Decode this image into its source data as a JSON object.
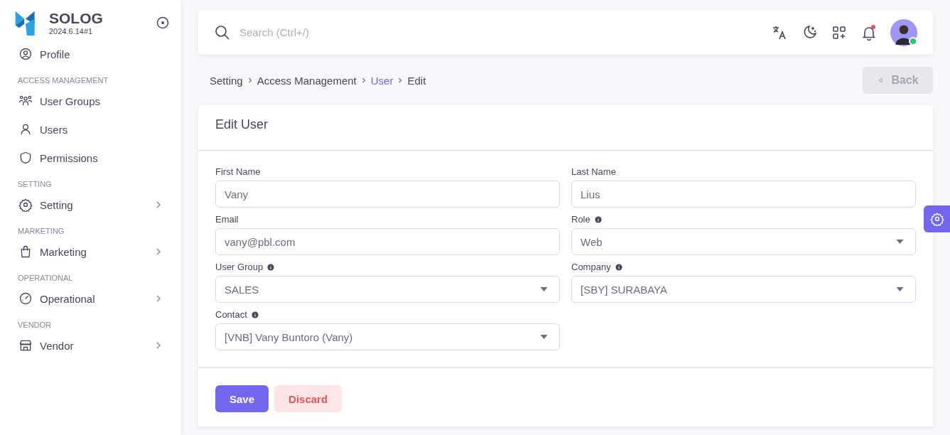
{
  "brand": {
    "name": "SOLOG",
    "version": "2024.6.14#1"
  },
  "sidebar": {
    "items": [
      {
        "label": "Profile",
        "has_children": false
      }
    ],
    "sections": [
      {
        "title": "ACCESS MANAGEMENT",
        "items": [
          {
            "label": "User Groups",
            "has_children": false
          },
          {
            "label": "Users",
            "has_children": false
          },
          {
            "label": "Permissions",
            "has_children": false
          }
        ]
      },
      {
        "title": "SETTING",
        "items": [
          {
            "label": "Setting",
            "has_children": true
          }
        ]
      },
      {
        "title": "MARKETING",
        "items": [
          {
            "label": "Marketing",
            "has_children": true
          }
        ]
      },
      {
        "title": "OPERATIONAL",
        "items": [
          {
            "label": "Operational",
            "has_children": true
          }
        ]
      },
      {
        "title": "VENDOR",
        "items": [
          {
            "label": "Vendor",
            "has_children": true
          }
        ]
      }
    ]
  },
  "topbar": {
    "search": {
      "placeholder": "Search (Ctrl+/)"
    },
    "notifications_unread": true,
    "user_online": true
  },
  "breadcrumb": [
    {
      "label": "Setting",
      "current": false
    },
    {
      "label": "Access Management",
      "current": false
    },
    {
      "label": "User",
      "current": true
    },
    {
      "label": "Edit",
      "current": false
    }
  ],
  "back_button": {
    "label": "Back",
    "disabled": true
  },
  "form": {
    "title": "Edit User",
    "fields": [
      {
        "label": "First Name",
        "kind": "text",
        "value": "Vany",
        "info": false
      },
      {
        "label": "Last Name",
        "kind": "text",
        "value": "Lius",
        "info": false
      },
      {
        "label": "Email",
        "kind": "text",
        "value": "vany@pbl.com",
        "info": false
      },
      {
        "label": "Role",
        "kind": "select",
        "value": "Web",
        "info": true
      },
      {
        "label": "User Group",
        "kind": "select",
        "value": "SALES",
        "info": true
      },
      {
        "label": "Company",
        "kind": "select",
        "value": "[SBY] SURABAYA",
        "info": true
      },
      {
        "label": "Contact",
        "kind": "select",
        "value": "[VNB] Vany Buntoro (Vany)",
        "info": true
      }
    ],
    "buttons": [
      {
        "label": "Save",
        "kind": "primary"
      },
      {
        "label": "Discard",
        "kind": "danger"
      }
    ]
  }
}
